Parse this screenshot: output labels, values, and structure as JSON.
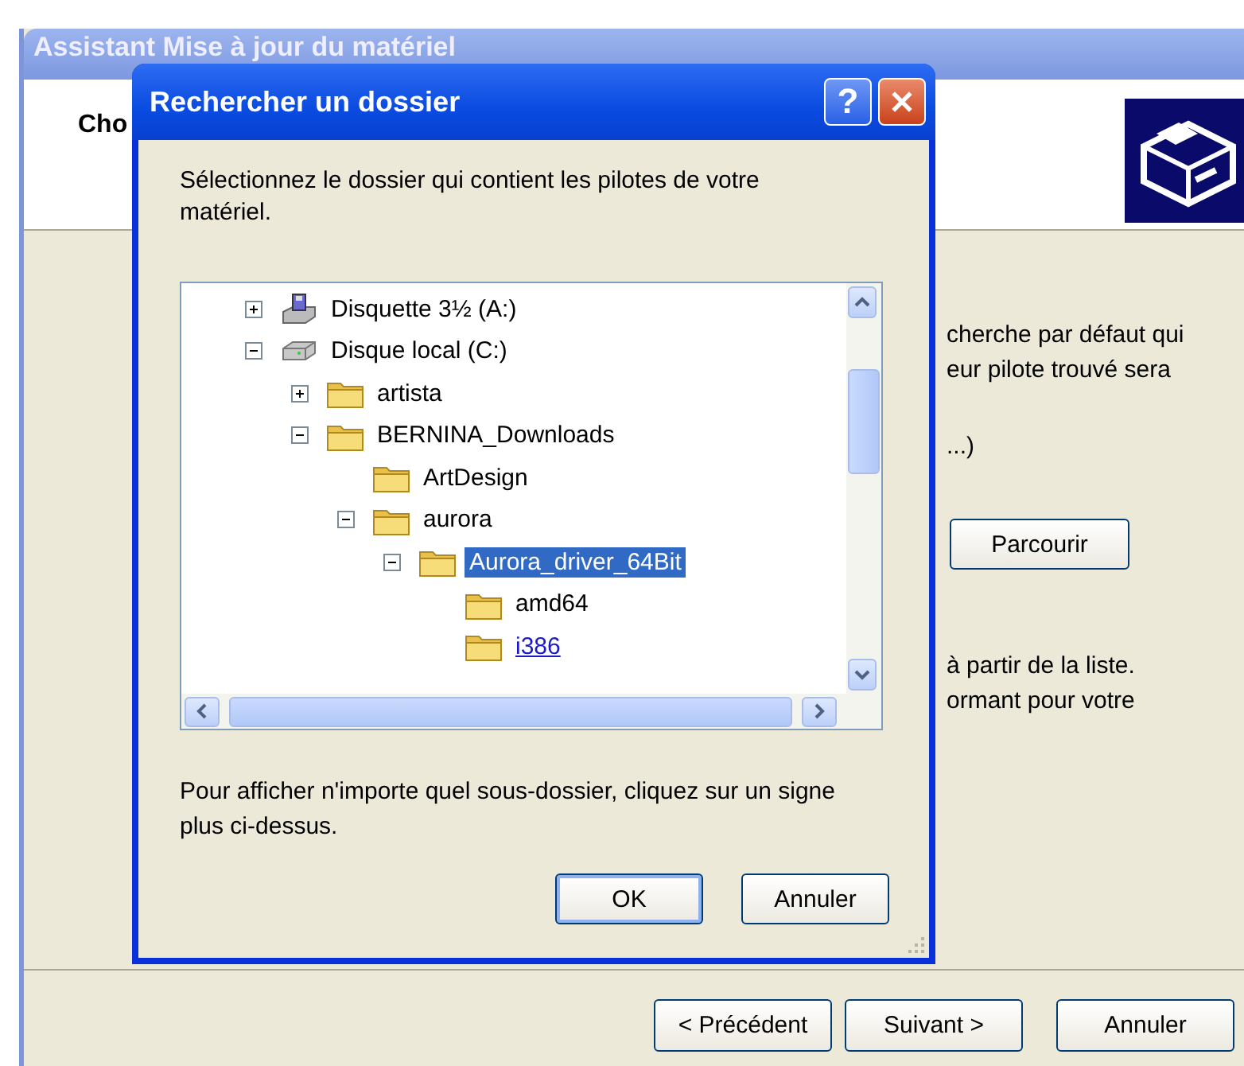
{
  "wizard": {
    "title": "Assistant Mise à jour du matériel",
    "heading": "Cho",
    "paragraphs": [
      {
        "lines": [
          "cherche par défaut qui",
          "eur pilote trouvé sera"
        ]
      },
      {
        "lines": [
          "...)"
        ]
      },
      {
        "lines": [
          "à partir de la liste.",
          "ormant pour votre"
        ]
      }
    ],
    "browse_button": "Parcourir",
    "buttons": [
      {
        "label": "< Précédent",
        "default": false
      },
      {
        "label": "Suivant >",
        "default": false
      },
      {
        "label": "Annuler",
        "default": false
      }
    ]
  },
  "dialog": {
    "title": "Rechercher un dossier",
    "help_button": "?",
    "prompt": "Sélectionnez le dossier qui contient les pilotes de votre matériel.",
    "tree": [
      {
        "label": "Disquette 3½ (A:)",
        "kind": "floppy",
        "expanded": false,
        "selected": false,
        "hot": false
      },
      {
        "label": "Disque local (C:)",
        "kind": "drive",
        "expanded": true,
        "selected": false,
        "hot": false,
        "children": [
          {
            "label": "artista",
            "kind": "folder",
            "expanded": false,
            "selected": false,
            "hot": false
          },
          {
            "label": "BERNINA_Downloads",
            "kind": "folder",
            "expanded": true,
            "selected": false,
            "hot": false,
            "children": [
              {
                "label": "ArtDesign",
                "kind": "folder",
                "selected": false,
                "hot": false
              },
              {
                "label": "aurora",
                "kind": "folder",
                "expanded": true,
                "selected": false,
                "hot": false,
                "children": [
                  {
                    "label": "Aurora_driver_64Bit",
                    "kind": "folder",
                    "expanded": true,
                    "selected": true,
                    "hot": false,
                    "children": [
                      {
                        "label": "amd64",
                        "kind": "folder",
                        "selected": false,
                        "hot": false
                      },
                      {
                        "label": "i386",
                        "kind": "folder",
                        "selected": false,
                        "hot": true
                      }
                    ]
                  }
                ]
              }
            ]
          }
        ]
      }
    ],
    "hint": "Pour afficher n'importe quel sous-dossier, cliquez sur un signe plus ci-dessus.",
    "buttons": [
      {
        "label": "OK",
        "default": true
      },
      {
        "label": "Annuler",
        "default": false
      }
    ]
  }
}
